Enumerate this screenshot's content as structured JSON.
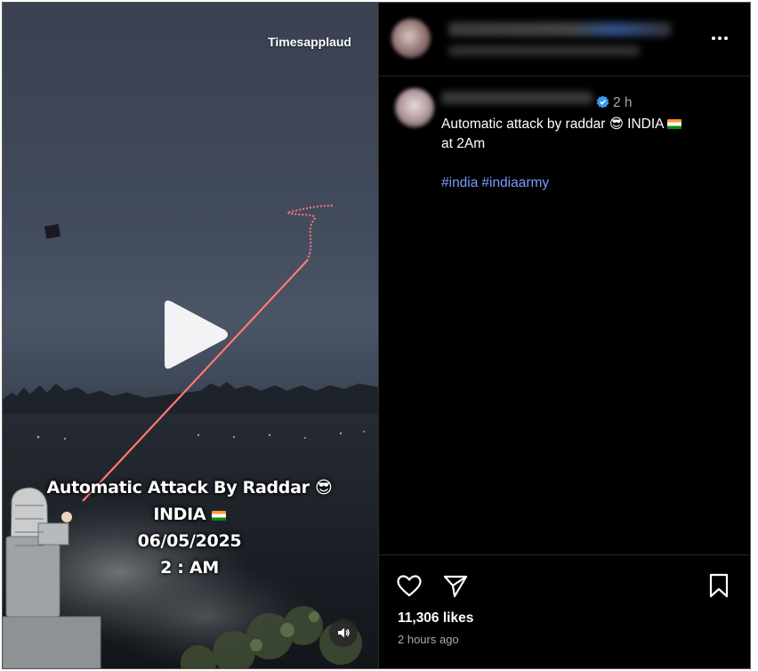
{
  "video": {
    "watermark": "Timesapplaud",
    "overlay_lines": [
      "Automatic Attack By Raddar",
      "INDIA",
      "06/05/2025",
      "2 : AM"
    ],
    "overlay_emoji": "😎"
  },
  "post": {
    "time_short": "2 h",
    "caption_line1": "Automatic attack by raddar",
    "caption_emoji": "😎",
    "caption_country": "INDIA",
    "caption_line2": "at 2Am",
    "hashtags": [
      "#india",
      "#indiaarmy"
    ],
    "likes": "11,306 likes",
    "posted_ago": "2 hours ago"
  },
  "icons": [
    "play-icon",
    "sound-icon",
    "more-options-icon",
    "verified-badge-icon",
    "heart-icon",
    "share-icon",
    "bookmark-icon"
  ],
  "colors": {
    "background": "#000000",
    "hashtag": "#7a98ff",
    "secondary_text": "#a8a8a8",
    "verified": "#3897f0"
  }
}
